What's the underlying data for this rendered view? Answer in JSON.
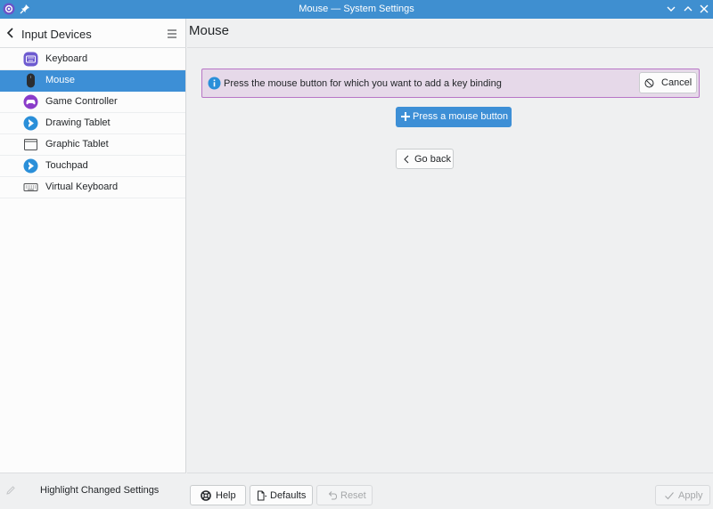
{
  "window": {
    "title": "Mouse — System Settings",
    "accent_color": "#3f8fd0"
  },
  "sidebar": {
    "title": "Input Devices",
    "items": [
      {
        "label": "Keyboard",
        "icon": "keyboard-icon",
        "active": false
      },
      {
        "label": "Mouse",
        "icon": "mouse-icon",
        "active": true
      },
      {
        "label": "Game Controller",
        "icon": "game-controller-icon",
        "active": false
      },
      {
        "label": "Drawing Tablet",
        "icon": "drawing-tablet-icon",
        "active": false
      },
      {
        "label": "Graphic Tablet",
        "icon": "graphic-tablet-icon",
        "active": false
      },
      {
        "label": "Touchpad",
        "icon": "touchpad-icon",
        "active": false
      },
      {
        "label": "Virtual Keyboard",
        "icon": "virtual-keyboard-icon",
        "active": false
      }
    ],
    "footer_label": "Highlight Changed Settings"
  },
  "main": {
    "title": "Mouse",
    "banner": {
      "message": "Press the mouse button for which you want to add a key binding",
      "cancel_label": "Cancel",
      "color": "#b876c6"
    },
    "press_button_label": "Press a mouse button",
    "go_back_label": "Go back"
  },
  "footer": {
    "help_label": "Help",
    "defaults_label": "Defaults",
    "reset_label": "Reset",
    "apply_label": "Apply"
  }
}
